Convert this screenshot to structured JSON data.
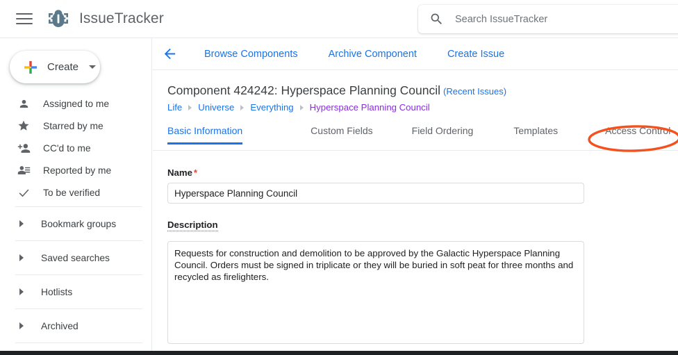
{
  "topbar": {
    "menu_icon": "hamburger-menu-icon",
    "logo_icon": "bug-logo-icon",
    "brand": "IssueTracker",
    "search": {
      "icon": "search-icon",
      "placeholder": "Search IssueTracker",
      "value": ""
    }
  },
  "sidebar": {
    "create": {
      "label": "Create",
      "plus_icon": "plus-icon",
      "caret_icon": "chevron-down-icon"
    },
    "nav_items": [
      {
        "label": "Assigned to me",
        "icon": "person-icon"
      },
      {
        "label": "Starred by me",
        "icon": "star-icon"
      },
      {
        "label": "CC'd to me",
        "icon": "person-add-icon"
      },
      {
        "label": "Reported by me",
        "icon": "person-list-icon"
      },
      {
        "label": "To be verified",
        "icon": "check-icon"
      }
    ],
    "groups": [
      {
        "label": "Bookmark groups",
        "icon": "chevron-right-icon"
      },
      {
        "label": "Saved searches",
        "icon": "chevron-right-icon"
      },
      {
        "label": "Hotlists",
        "icon": "chevron-right-icon"
      },
      {
        "label": "Archived",
        "icon": "chevron-right-icon"
      }
    ]
  },
  "main": {
    "back_icon": "back-arrow-icon",
    "actions": [
      "Browse Components",
      "Archive Component",
      "Create Issue"
    ],
    "title": "Component 424242: Hyperspace Planning Council",
    "recent_issues": "(Recent Issues)",
    "breadcrumb": [
      {
        "label": "Life",
        "visited": false
      },
      {
        "label": "Universe",
        "visited": false
      },
      {
        "label": "Everything",
        "visited": false
      },
      {
        "label": "Hyperspace Planning Council",
        "visited": true
      }
    ],
    "tabs": [
      {
        "label": "Basic Information",
        "active": true,
        "highlighted": false
      },
      {
        "label": "Custom Fields",
        "active": false,
        "highlighted": false
      },
      {
        "label": "Field Ordering",
        "active": false,
        "highlighted": false
      },
      {
        "label": "Templates",
        "active": false,
        "highlighted": false
      },
      {
        "label": "Access Control",
        "active": false,
        "highlighted": true
      }
    ],
    "form": {
      "name_label": "Name",
      "name_required_mark": "*",
      "name_value": "Hyperspace Planning Council",
      "description_label": "Description",
      "description_value": "Requests for construction and demolition to be approved by the Galactic Hyperspace Planning Council. Orders must be signed in triplicate or they will be buried in soft peat for three months and recycled as firelighters."
    }
  },
  "colors": {
    "link_blue": "#1a73e8",
    "visited_purple": "#8a2be2",
    "annotation_orange": "#f4511e",
    "required_red": "#ea4335",
    "text_primary": "#3c4043",
    "logo_slate": "#5a7a8c"
  }
}
